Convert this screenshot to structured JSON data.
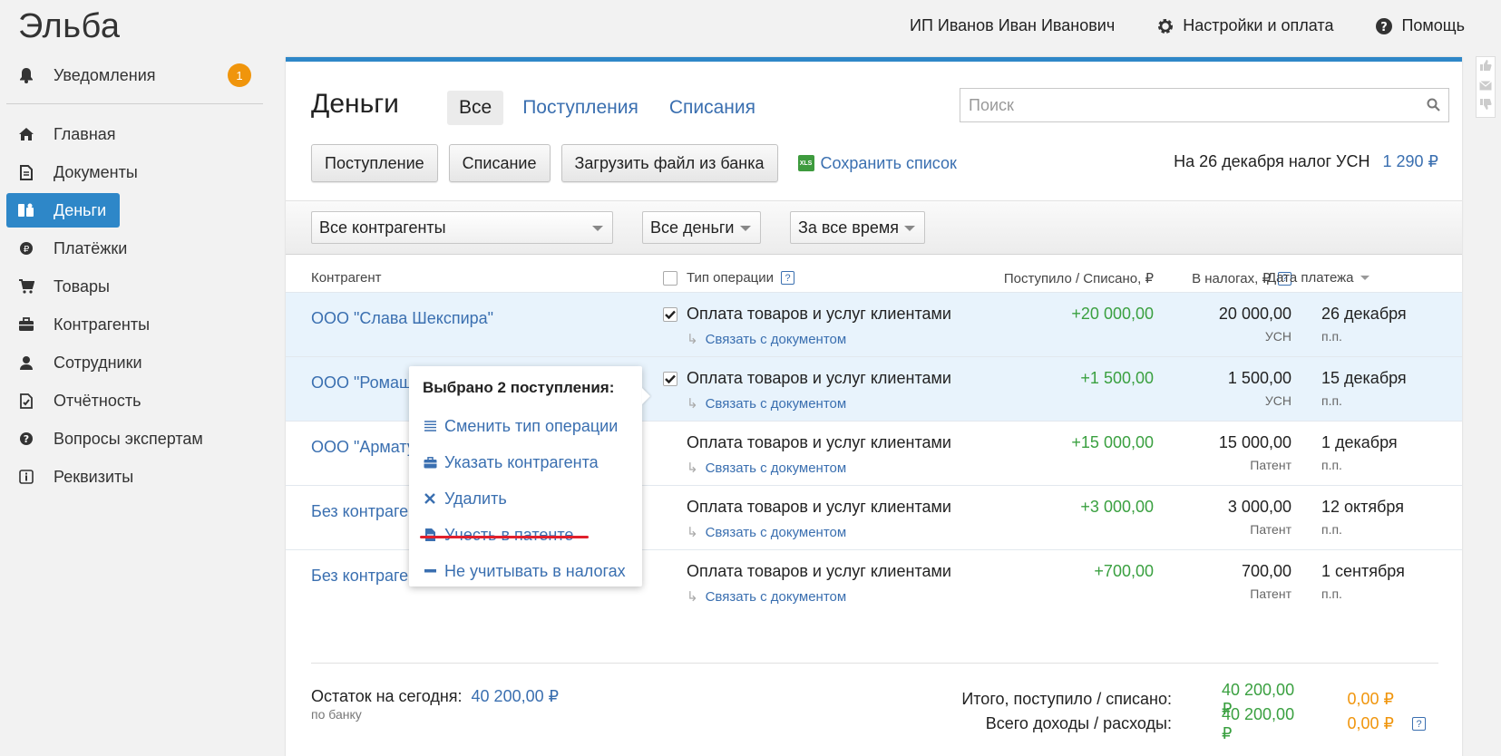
{
  "app": {
    "logo": "Эльба"
  },
  "sidebar": {
    "notifications": {
      "label": "Уведомления",
      "count": "1"
    },
    "items": [
      {
        "label": "Главная",
        "icon": "home-icon"
      },
      {
        "label": "Документы",
        "icon": "document-icon"
      },
      {
        "label": "Деньги",
        "icon": "money-icon",
        "active": true
      },
      {
        "label": "Платёжки",
        "icon": "payment-icon"
      },
      {
        "label": "Товары",
        "icon": "cart-icon"
      },
      {
        "label": "Контрагенты",
        "icon": "briefcase-icon"
      },
      {
        "label": "Сотрудники",
        "icon": "person-icon"
      },
      {
        "label": "Отчётность",
        "icon": "report-icon"
      },
      {
        "label": "Вопросы экспертам",
        "icon": "question-icon"
      },
      {
        "label": "Реквизиты",
        "icon": "info-icon"
      }
    ]
  },
  "topbar": {
    "user": "ИП Иванов Иван Иванович",
    "settings": "Настройки и оплата",
    "help": "Помощь"
  },
  "main": {
    "title": "Деньги",
    "tabs": [
      "Все",
      "Поступления",
      "Списания"
    ],
    "search_placeholder": "Поиск",
    "buttons": {
      "income": "Поступление",
      "expense": "Списание",
      "upload": "Загрузить файл из банка",
      "save_list": "Сохранить список",
      "xls": "XLS"
    },
    "tax_note": {
      "label": "На 26 декабря налог УСН",
      "value": "1 290 ₽"
    },
    "filters": {
      "counterparty": "Все контрагенты",
      "money": "Все деньги",
      "period": "За все время"
    },
    "columns": {
      "counterparty": "Контрагент",
      "op_type": "Тип операции",
      "amount": "Поступило / Списано, ₽",
      "tax": "В налогах, ₽",
      "date": "Дата платежа"
    },
    "rows": [
      {
        "counterparty": "ООО \"Слава Шекспира\"",
        "op": "Оплата товаров и услуг клиентами",
        "link": "Связать с документом",
        "amount": "+20 000,00",
        "tax": "20 000,00",
        "tax_type": "УСН",
        "date": "26 декабря",
        "pp": "п.п.",
        "checked": true
      },
      {
        "counterparty": "ООО \"Ромашка\"",
        "op": "Оплата товаров и услуг клиентами",
        "link": "Связать с документом",
        "amount": "+1 500,00",
        "tax": "1 500,00",
        "tax_type": "УСН",
        "date": "15 декабря",
        "pp": "п.п.",
        "checked": true
      },
      {
        "counterparty": "ООО \"Арматура\"",
        "op": "Оплата товаров и услуг клиентами",
        "link": "Связать с документом",
        "amount": "+15 000,00",
        "tax": "15 000,00",
        "tax_type": "Патент",
        "date": "1 декабря",
        "pp": "п.п.",
        "checked": false
      },
      {
        "counterparty": "Без контрагента",
        "op": "Оплата товаров и услуг клиентами",
        "link": "Связать с документом",
        "amount": "+3 000,00",
        "tax": "3 000,00",
        "tax_type": "Патент",
        "date": "12 октября",
        "pp": "п.п.",
        "checked": false
      },
      {
        "counterparty": "Без контрагента",
        "op": "Оплата товаров и услуг клиентами",
        "link": "Связать с документом",
        "amount": "+700,00",
        "tax": "700,00",
        "tax_type": "Патент",
        "date": "1 сентября",
        "pp": "п.п.",
        "checked": false
      }
    ],
    "footer": {
      "balance_label": "Остаток на сегодня:",
      "balance_value": "40 200,00 ₽",
      "balance_sub": "по банку",
      "total_label": "Итого, поступило / списано:",
      "total_in": "40 200,00 ₽",
      "total_out": "0,00 ₽",
      "all_label": "Всего доходы / расходы:",
      "all_in": "40 200,00 ₽",
      "all_out": "0,00 ₽"
    }
  },
  "popup": {
    "header": "Выбрано 2 поступления:",
    "items": [
      {
        "label": "Сменить тип операции",
        "icon": "list-icon"
      },
      {
        "label": "Указать контрагента",
        "icon": "briefcase-icon"
      },
      {
        "label": "Удалить",
        "icon": "close-icon"
      },
      {
        "label": "Учесть в патенте",
        "icon": "document-icon"
      },
      {
        "label": "Не учитывать в налогах",
        "icon": "minus-icon"
      }
    ]
  },
  "colors": {
    "accent": "#2e87c8",
    "link": "#3a6fb0",
    "income": "#3aa040",
    "warning": "#f0950c",
    "highlight": "#e8f3fc"
  }
}
